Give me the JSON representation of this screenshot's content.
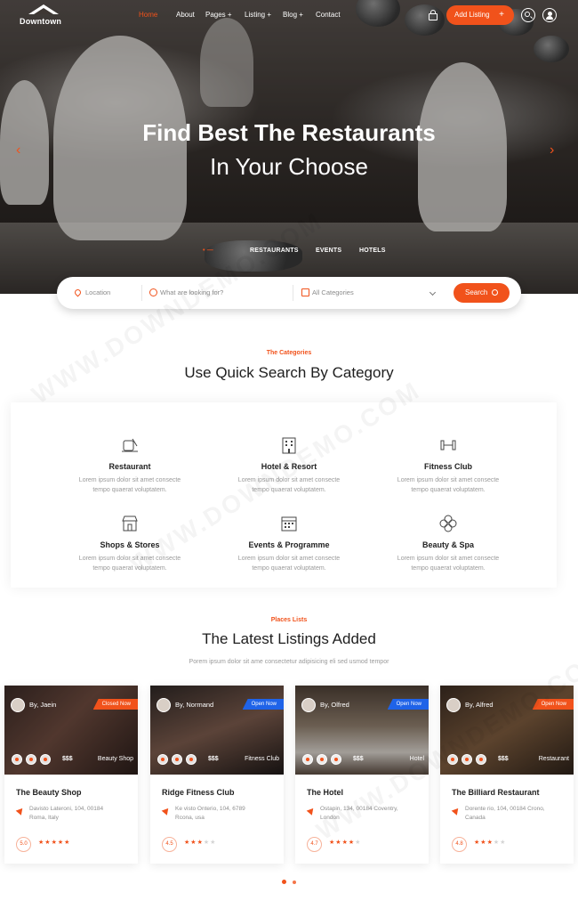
{
  "brand": {
    "name": "Downtown"
  },
  "nav": {
    "links": [
      "Home",
      "About",
      "Pages +",
      "Listing +",
      "Blog +",
      "Contact"
    ],
    "add_listing": "Add Listing",
    "add_listing_plus": "+"
  },
  "hero": {
    "title_line1": "Find Best The Restaurants",
    "title_line2": "In Your Choose",
    "tabs": [
      "RESTAURANTS",
      "EVENTS",
      "HOTELS"
    ]
  },
  "search": {
    "location_placeholder": "Location",
    "keyword_placeholder": "What are looking for?",
    "category_value": "All Categories",
    "button": "Search"
  },
  "categories_section": {
    "eyebrow": "The Categories",
    "title": "Use Quick Search By Category",
    "items": [
      {
        "name": "Restaurant",
        "desc1": "Lorem ipsum dolor sit amet consecte",
        "desc2": "tempo quaerat voluptatem.",
        "icon": "restaurant-icon"
      },
      {
        "name": "Hotel & Resort",
        "desc1": "Lorem ipsum dolor sit amet consecte",
        "desc2": "tempo quaerat voluptatem.",
        "icon": "hotel-icon"
      },
      {
        "name": "Fitness Club",
        "desc1": "Lorem ipsum dolor sit amet consecte",
        "desc2": "tempo quaerat voluptatem.",
        "icon": "dumbbell-icon"
      },
      {
        "name": "Shops & Stores",
        "desc1": "Lorem ipsum dolor sit amet consecte",
        "desc2": "tempo quaerat voluptatem.",
        "icon": "shop-icon"
      },
      {
        "name": "Events & Programme",
        "desc1": "Lorem ipsum dolor sit amet consecte",
        "desc2": "tempo quaerat voluptatem.",
        "icon": "calendar-icon"
      },
      {
        "name": "Beauty & Spa",
        "desc1": "Lorem ipsum dolor sit amet consecte",
        "desc2": "tempo quaerat voluptatem.",
        "icon": "flower-icon"
      }
    ]
  },
  "listings_section": {
    "eyebrow": "Places Lists",
    "title": "The Latest Listings Added",
    "subtitle": "Porem ipsum dolor sit ame consectetur adipisicing eli sed usmod tempor",
    "cards": [
      {
        "author": "By, Jaein",
        "status": "Closed Now",
        "status_color": "#f1521b",
        "price": "$$$",
        "type": "Beauty Shop",
        "name": "The Beauty Shop",
        "addr1": "Davisto Lateroni, 104, 00184",
        "addr2": "Roma, Italy",
        "rating": "5.0",
        "stars": 5
      },
      {
        "author": "By, Normand",
        "status": "Open Now",
        "status_color": "#1f63e8",
        "price": "$$$",
        "type": "Fitness Club",
        "name": "Ridge Fitness Club",
        "addr1": "Ke visto Onterio, 104, 6789",
        "addr2": "Rcona, usa",
        "rating": "4.5",
        "stars": 3
      },
      {
        "author": "By, Olfred",
        "status": "Open Now",
        "status_color": "#1f63e8",
        "price": "$$$",
        "type": "Hotel",
        "name": "The Hotel",
        "addr1": "Ostapin, 134, 00184 Coventry,",
        "addr2": "London",
        "rating": "4.7",
        "stars": 4
      },
      {
        "author": "By, Alfred",
        "status": "Open Now",
        "status_color": "#f1521b",
        "price": "$$$",
        "type": "Restaurant",
        "name": "The Billiard Restaurant",
        "addr1": "Dorente rio, 104, 00184 Crono,",
        "addr2": "Canada",
        "rating": "4.8",
        "stars": 3
      }
    ]
  },
  "watermark": "WWW.DOWNDEMO.COM",
  "colors": {
    "accent": "#f1521b",
    "open_badge": "#1f63e8"
  }
}
